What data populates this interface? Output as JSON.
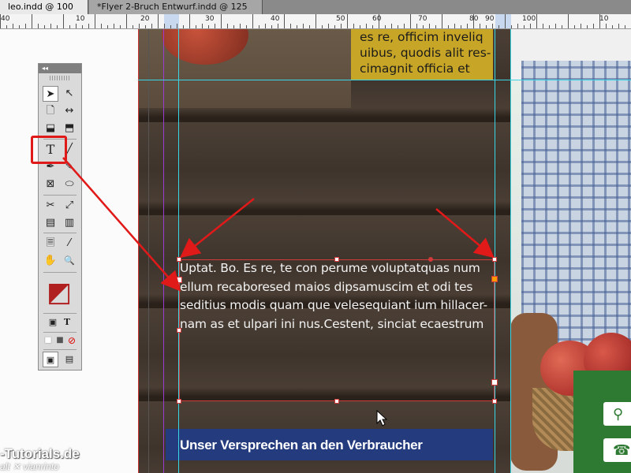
{
  "tabs": [
    {
      "label": "leo.indd @ 100 %",
      "close": "×"
    },
    {
      "label": "*Flyer 2-Bruch Entwurf.indd @ 125 %",
      "close": "×"
    }
  ],
  "ruler": {
    "labels": [
      "40",
      "10",
      "20",
      "30",
      "40",
      "50",
      "60",
      "70",
      "80",
      "90",
      "100",
      "10"
    ]
  },
  "toolbox": {
    "collapse_glyph": "◂◂",
    "tools": [
      {
        "name": "selection-tool",
        "glyph": "➤"
      },
      {
        "name": "direct-selection-tool",
        "glyph": "↖"
      },
      {
        "name": "page-tool",
        "glyph": "🗋"
      },
      {
        "name": "gap-tool",
        "glyph": "↔"
      },
      {
        "name": "content-collector-tool",
        "glyph": "⬓"
      },
      {
        "name": "content-placer-tool",
        "glyph": "⬒"
      },
      {
        "name": "type-tool",
        "glyph": "T"
      },
      {
        "name": "line-tool",
        "glyph": "╱"
      },
      {
        "name": "pen-tool",
        "glyph": "✒"
      },
      {
        "name": "pencil-tool",
        "glyph": "✎"
      },
      {
        "name": "rectangle-frame-tool",
        "glyph": "⊠"
      },
      {
        "name": "ellipse-tool",
        "glyph": "⬭"
      },
      {
        "name": "scissors-tool",
        "glyph": "✂"
      },
      {
        "name": "free-transform-tool",
        "glyph": "⤢"
      },
      {
        "name": "gradient-swatch-tool",
        "glyph": "▤"
      },
      {
        "name": "gradient-feather-tool",
        "glyph": "▥"
      },
      {
        "name": "note-tool",
        "glyph": "🗏"
      },
      {
        "name": "eyedropper-tool",
        "glyph": "⁄"
      },
      {
        "name": "hand-tool",
        "glyph": "✋"
      },
      {
        "name": "zoom-tool",
        "glyph": "🔍"
      },
      {
        "name": "fill-stroke-swatch",
        "glyph": "◩"
      },
      {
        "name": "formatting-container",
        "glyph": "▣"
      },
      {
        "name": "formatting-text",
        "glyph": "T"
      },
      {
        "name": "apply-color",
        "glyph": "■"
      },
      {
        "name": "apply-gradient",
        "glyph": "■"
      },
      {
        "name": "apply-none",
        "glyph": "⊘"
      },
      {
        "name": "normal-view-mode",
        "glyph": "▣"
      },
      {
        "name": "screen-mode",
        "glyph": "▤"
      }
    ]
  },
  "document": {
    "yellow_box_text": "es re, officim inveliq uibus, quodis alit res- cimagnit officia et",
    "body_text": "Uptat. Bo. Es re, te con perume voluptatquas num ellum recaboresed maios dipsamuscim et odi tes seditius modis quam que velesequiant ium hillacer- nam as et ulpari ini nus.Cestent, sinciat ecaestrum",
    "banner_text": "Unser Versprechen an den Verbraucher",
    "green_icons": [
      "⚲",
      "☎"
    ]
  },
  "watermark": {
    "line1": "-Tutorials.de",
    "line2": "alt ✕ vianrinto"
  },
  "colors": {
    "annotation": "#e01919",
    "guide": "#3ad6e6",
    "banner": "#243b7e",
    "yellow_box": "#c7a526"
  }
}
